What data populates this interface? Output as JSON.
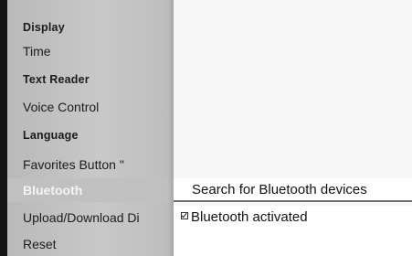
{
  "menu": {
    "items": [
      {
        "label": "Display"
      },
      {
        "label": "Time"
      },
      {
        "label": "Text Reader"
      },
      {
        "label": "Voice Control"
      },
      {
        "label": "Language"
      },
      {
        "label": "Favorites Button \""
      },
      {
        "label": "Bluetooth",
        "selected": true
      },
      {
        "label": "Upload/Download Di"
      },
      {
        "label": "Reset"
      }
    ]
  },
  "bluetooth_panel": {
    "search_label": "Search for Bluetooth devices",
    "activated_label": "Bluetooth activated",
    "activated_checked": true
  },
  "colors": {
    "menu_background": "#c3c3c3",
    "selected_text": "#f4f4f4",
    "content_background": "#f7f7f7"
  }
}
